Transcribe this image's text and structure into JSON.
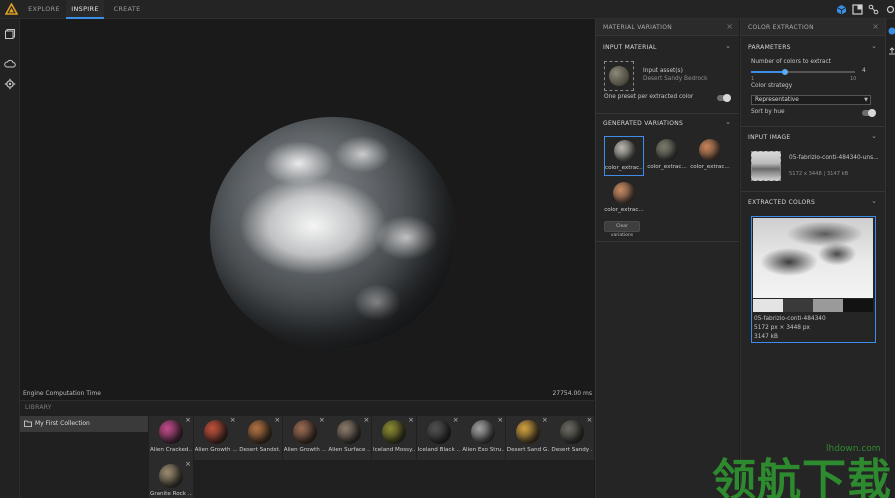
{
  "topbar": {
    "tabs": [
      {
        "label": "EXPLORE",
        "active": false
      },
      {
        "label": "INSPIRE",
        "active": true
      },
      {
        "label": "CREATE",
        "active": false
      }
    ]
  },
  "viewport": {
    "engine_label": "Engine Computation Time",
    "engine_time": "27754.00 ms"
  },
  "library": {
    "title": "LIBRARY",
    "collection": "My First Collection",
    "items": [
      {
        "label": "Alien Cracked...",
        "color": "#c04a8a"
      },
      {
        "label": "Alien Growth ...",
        "color": "#c0503a"
      },
      {
        "label": "Desert Sandst...",
        "color": "#b07040"
      },
      {
        "label": "Alien Growth ...",
        "color": "#9a6a50"
      },
      {
        "label": "Alien Surface ...",
        "color": "#8a7a6a"
      },
      {
        "label": "Iceland Mossy...",
        "color": "#8a8a30"
      },
      {
        "label": "Iceland Black ...",
        "color": "#505050"
      },
      {
        "label": "Alien Exo Stru...",
        "color": "#a0a0a0"
      },
      {
        "label": "Desert Sand G...",
        "color": "#d0a040"
      },
      {
        "label": "Desert Sandy ...",
        "color": "#6a6a60"
      },
      {
        "label": "Granite Rock ...",
        "color": "#9a8a70"
      }
    ]
  },
  "material_panel": {
    "title": "MATERIAL VARIATION",
    "input_section": "INPUT MATERIAL",
    "input_label": "Input asset(s)",
    "input_value": "Desert Sandy Bedrock",
    "toggle_label": "One preset per extracted color",
    "generated_section": "GENERATED VARIATIONS",
    "variations": [
      {
        "label": "color_extrac...",
        "color": "#b8b6ae",
        "selected": true
      },
      {
        "label": "color_extrac...",
        "color": "#7a7a6c",
        "selected": false
      },
      {
        "label": "color_extrac...",
        "color": "#c9845a",
        "selected": false
      },
      {
        "label": "color_extrac...",
        "color": "#c98a62",
        "selected": false
      }
    ],
    "clear_button": "Clear variations"
  },
  "color_panel": {
    "title": "COLOR EXTRACTION",
    "params_section": "PARAMETERS",
    "num_colors_label": "Number of colors to extract",
    "num_colors_value": "4",
    "slider_min": "1",
    "slider_max": "10",
    "slider_fraction": 0.33,
    "strategy_label": "Color strategy",
    "strategy_value": "Representative",
    "sort_label": "Sort by hue",
    "input_image_section": "INPUT IMAGE",
    "image_name": "05-fabrizio-conti-484340-uns...",
    "image_meta": "5172 x 3448 | 3147 kB",
    "extracted_section": "EXTRACTED COLORS",
    "swatches": [
      "#e4e4e4",
      "#3a3a3a",
      "#9a9a9a",
      "#121212"
    ],
    "photo_name": "05-fabrizio-conti-484340",
    "photo_size": "5172 px × 3448 px",
    "photo_kb": "3147 kB"
  },
  "watermark": {
    "text": "领航下载",
    "url": "lhdown.com"
  }
}
